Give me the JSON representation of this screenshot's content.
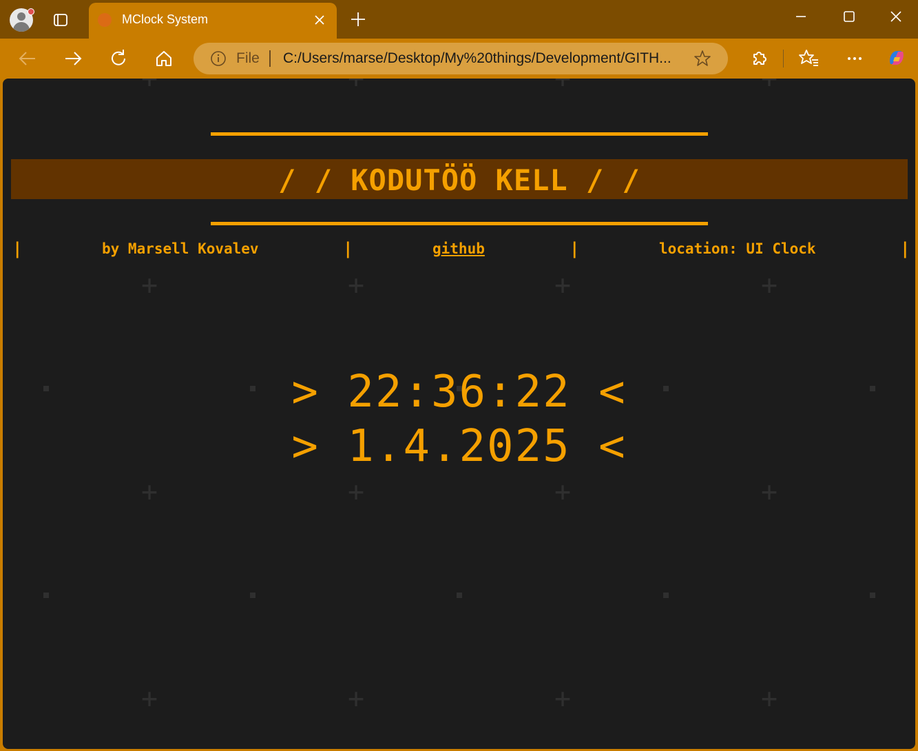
{
  "browser": {
    "tab": {
      "title": "MClock System"
    },
    "address_bar": {
      "scheme_label": "File",
      "url": "C:/Users/marse/Desktop/My%20things/Development/GITH..."
    },
    "colors": {
      "frame": "#7c4c00",
      "toolbar": "#c97d00",
      "accent": "#f5a000"
    }
  },
  "page": {
    "banner": {
      "title": "/ / KODUTÖÖ KELL / /"
    },
    "nav": {
      "author": "by Marsell Kovalev",
      "github_link": "github",
      "location": "location: UI Clock",
      "separator": "|"
    },
    "clock": {
      "prefix": ">",
      "suffix": "<",
      "time": "22:36:22",
      "date": "1.4.2025"
    }
  }
}
